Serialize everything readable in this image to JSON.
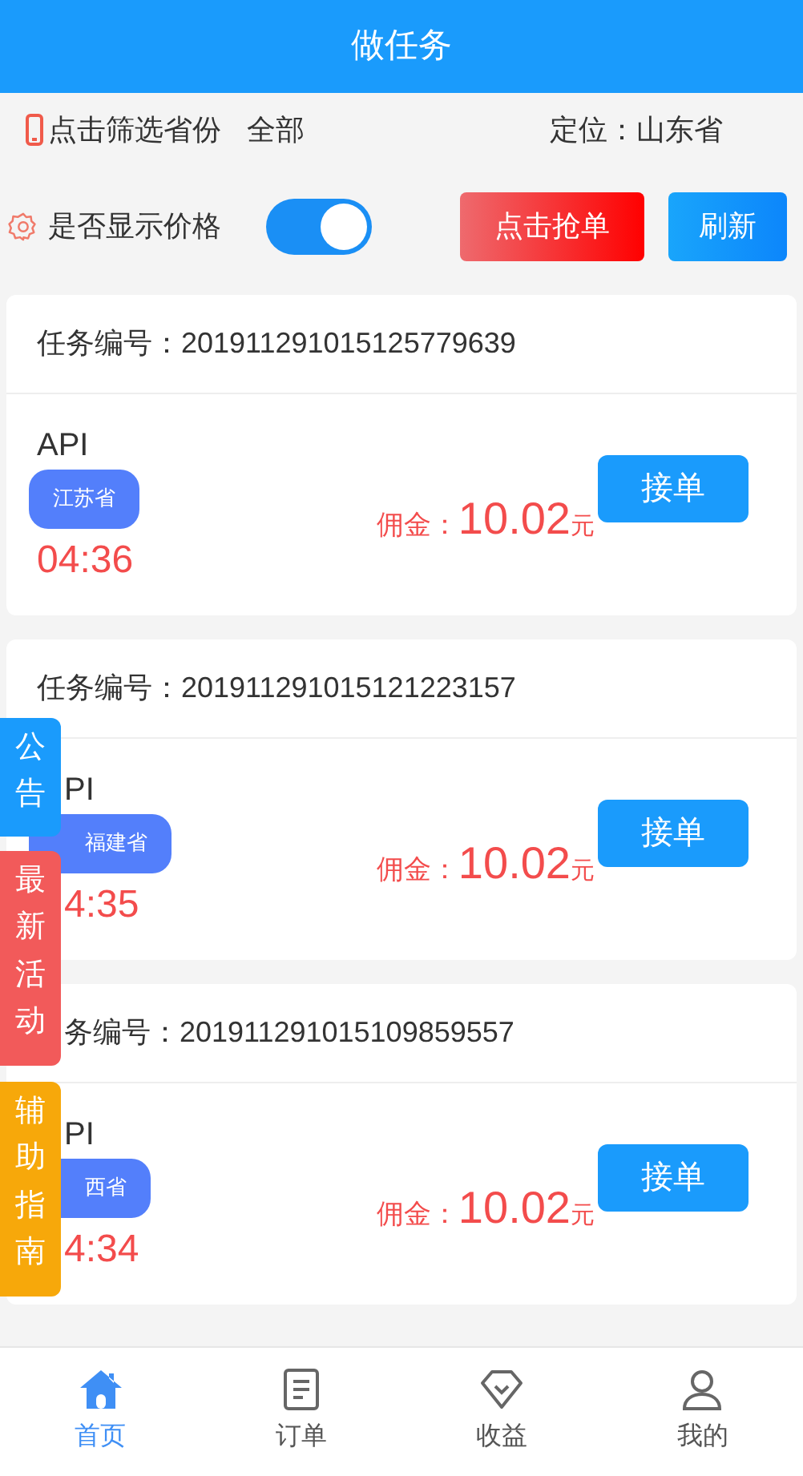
{
  "header": {
    "title": "做任务"
  },
  "filter": {
    "label": "点击筛选省份",
    "value": "全部",
    "location": "定位：山东省"
  },
  "price_toggle": {
    "label": "是否显示价格",
    "on": true
  },
  "actions": [
    {
      "label": "点击抢单",
      "kind": "grab"
    },
    {
      "label": "刷新",
      "kind": "refresh"
    }
  ],
  "tasks": [
    {
      "number_text": "任务编号：201911291015125779639",
      "title": "API",
      "province": "江苏省",
      "time": "04:36",
      "commission_label": "佣金：",
      "amount": "10.02",
      "unit": "元",
      "button": "接单"
    },
    {
      "number_text": "任务编号：201911291015121223157",
      "title": "PI",
      "province": "福建省",
      "time": "4:35",
      "commission_label": "佣金：",
      "amount": "10.02",
      "unit": "元",
      "button": "接单"
    },
    {
      "number_text": "务编号：201911291015109859557",
      "title": "PI",
      "province": "西省",
      "time": "4:34",
      "commission_label": "佣金：",
      "amount": "10.02",
      "unit": "元",
      "button": "接单"
    }
  ],
  "side_tabs": [
    {
      "label": "公告",
      "color": "#1a9bfc"
    },
    {
      "label": "最新活动",
      "color": "#f25a5a"
    },
    {
      "label": "辅助指南",
      "color": "#f7a80a"
    }
  ],
  "tabbar": [
    {
      "label": "首页",
      "kind": "home",
      "selected": true
    },
    {
      "label": "订单",
      "kind": "order",
      "selected": false
    },
    {
      "label": "收益",
      "kind": "income",
      "selected": false
    },
    {
      "label": "我的",
      "kind": "user",
      "selected": false
    }
  ]
}
